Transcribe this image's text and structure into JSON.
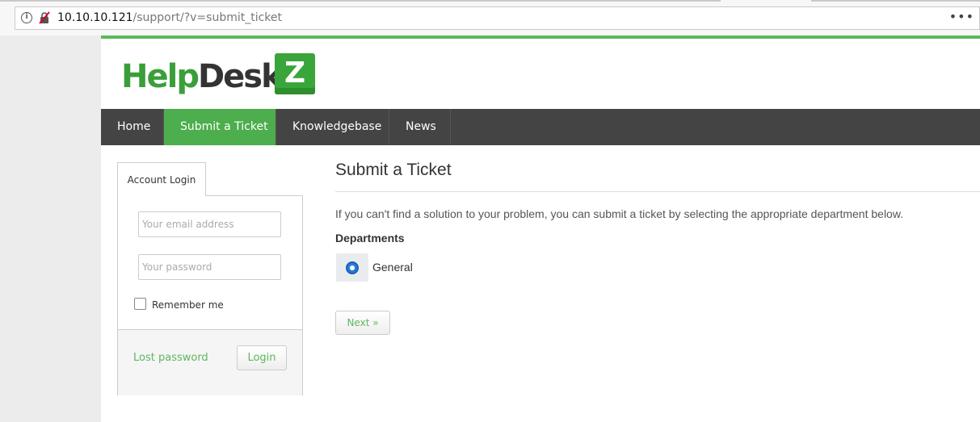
{
  "browser": {
    "url_host": "10.10.10.121",
    "url_path": "/support/?v=submit_ticket",
    "menu_glyph": "•••"
  },
  "logo": {
    "part1": "Help",
    "part2": "Desk",
    "box_letter": "Z"
  },
  "nav": {
    "items": [
      {
        "label": "Home"
      },
      {
        "label": "Submit a Ticket"
      },
      {
        "label": "Knowledgebase"
      },
      {
        "label": "News"
      }
    ],
    "active_index": 1
  },
  "sidebar": {
    "tab_label": "Account Login",
    "email_placeholder": "Your email address",
    "password_placeholder": "Your password",
    "remember_label": "Remember me",
    "lost_password_label": "Lost password",
    "login_button_label": "Login"
  },
  "main": {
    "title": "Submit a Ticket",
    "intro": "If you can't find a solution to your problem, you can submit a ticket by selecting the appropriate department below.",
    "departments_label": "Departments",
    "departments": [
      {
        "label": "General",
        "selected": true
      }
    ],
    "next_button_label": "Next »"
  },
  "colors": {
    "brand_green": "#5cb85c",
    "nav_bg": "#444444",
    "nav_active": "#4cae4c"
  }
}
